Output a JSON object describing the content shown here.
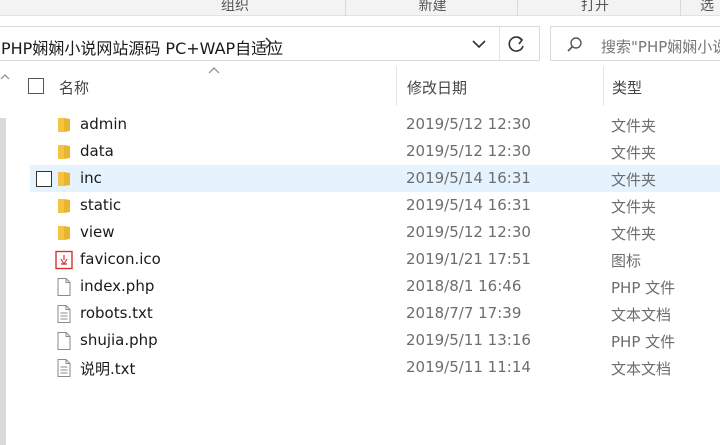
{
  "ribbon": {
    "groups": [
      "组织",
      "新建",
      "打开",
      "选"
    ]
  },
  "address": {
    "path": "PHP娴娴小说网站源码 PC+WAP自适应"
  },
  "search": {
    "placeholder": "搜索\"PHP娴娴小说"
  },
  "columns": {
    "name": "名称",
    "date": "修改日期",
    "type": "类型"
  },
  "files": [
    {
      "name": "admin",
      "date": "2019/5/12 12:30",
      "type": "文件夹",
      "icon": "folder-icon"
    },
    {
      "name": "data",
      "date": "2019/5/12 12:30",
      "type": "文件夹",
      "icon": "folder-icon"
    },
    {
      "name": "inc",
      "date": "2019/5/14 16:31",
      "type": "文件夹",
      "icon": "folder-icon",
      "hovered": true
    },
    {
      "name": "static",
      "date": "2019/5/14 16:31",
      "type": "文件夹",
      "icon": "folder-icon"
    },
    {
      "name": "view",
      "date": "2019/5/12 12:30",
      "type": "文件夹",
      "icon": "folder-icon"
    },
    {
      "name": "favicon.ico",
      "date": "2019/1/21 17:51",
      "type": "图标",
      "icon": "ico-file-icon"
    },
    {
      "name": "index.php",
      "date": "2018/8/1 16:46",
      "type": "PHP 文件",
      "icon": "blank-file-icon"
    },
    {
      "name": "robots.txt",
      "date": "2018/7/7 17:39",
      "type": "文本文档",
      "icon": "text-file-icon"
    },
    {
      "name": "shujia.php",
      "date": "2019/5/11 13:16",
      "type": "PHP 文件",
      "icon": "blank-file-icon"
    },
    {
      "name": "说明.txt",
      "date": "2019/5/11 11:14",
      "type": "文本文档",
      "icon": "text-file-icon"
    }
  ],
  "colors": {
    "hover_row": "#e5f3ff",
    "folder": "#f5c542",
    "ico_red": "#d9342b"
  }
}
